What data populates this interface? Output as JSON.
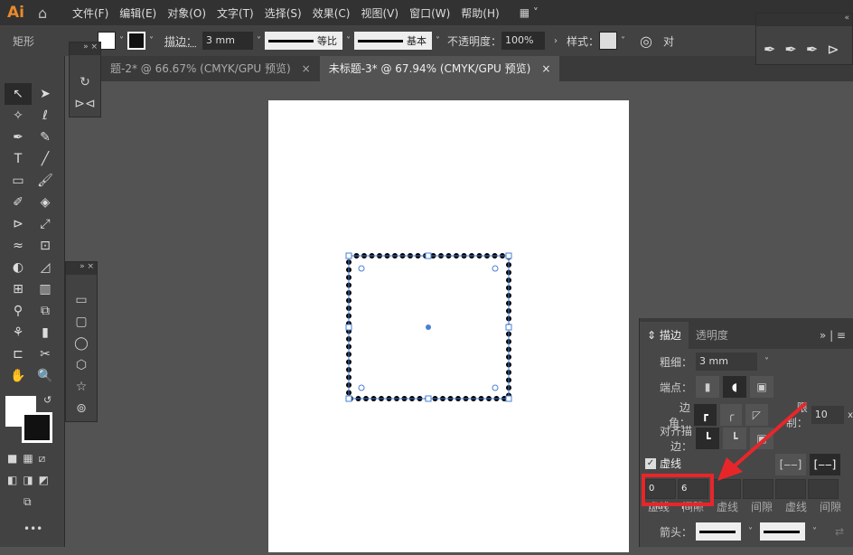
{
  "app": {
    "logo": "Ai",
    "menu": [
      "文件(F)",
      "编辑(E)",
      "对象(O)",
      "文字(T)",
      "选择(S)",
      "效果(C)",
      "视图(V)",
      "窗口(W)",
      "帮助(H)"
    ]
  },
  "control": {
    "object_type": "矩形",
    "stroke_label": "描边：",
    "stroke_weight": "3 mm",
    "profile": "等比",
    "brush": "基本",
    "opacity_label": "不透明度：",
    "opacity": "100%",
    "style_label": "样式：",
    "align_label": "对"
  },
  "tabs": [
    {
      "label": "题-2* @ 66.67% (CMYK/GPU 预览)",
      "close": "×"
    },
    {
      "label": "未标题-3* @ 67.94% (CMYK/GPU 预览)",
      "close": "×"
    }
  ],
  "stroke_panel": {
    "tab_stroke": "描边",
    "tab_transparency": "透明度",
    "weight_label": "粗细：",
    "weight": "3 mm",
    "cap_label": "端点：",
    "corner_label": "边角：",
    "limit_label": "限制：",
    "limit": "10",
    "limit_unit": "x",
    "align_label": "对齐描边：",
    "dashed_label": "虚线",
    "dashed_checked": true,
    "dash_values": [
      "0 mm",
      "6 mm",
      "",
      "",
      "",
      ""
    ],
    "dash_captions": [
      "虚线",
      "间隙",
      "虚线",
      "间隙",
      "虚线",
      "间隙"
    ],
    "arrow_label": "箭头："
  },
  "colors": {
    "highlight": "#e8262a",
    "accent": "#e8892c"
  }
}
